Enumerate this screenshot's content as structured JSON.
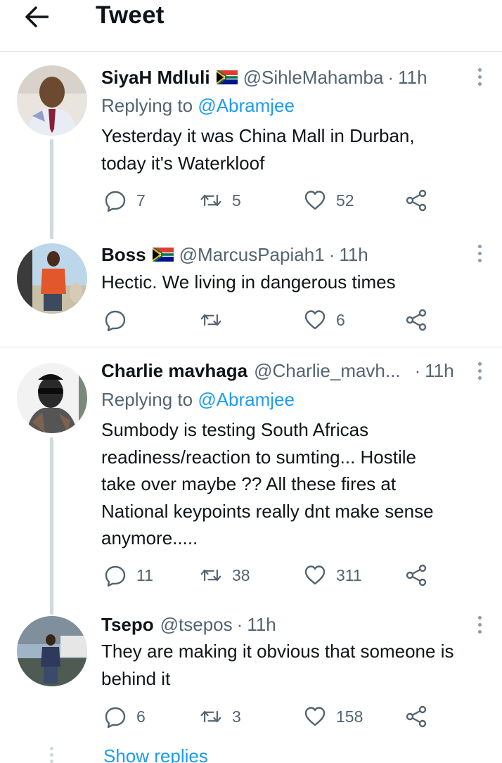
{
  "header": {
    "title": "Tweet",
    "back_icon": "arrow-left-icon"
  },
  "tweets": [
    {
      "name": "SiyaH Mdluli",
      "flag": true,
      "handle": "@SihleMahamba",
      "time": "11h",
      "replying_label": "Replying to",
      "replying_to": "@Abramjee",
      "text_lines": [
        "Yesterday it was China Mall in Durban,",
        "today it's Waterkloof"
      ],
      "replies": "7",
      "retweets": "5",
      "likes": "52"
    },
    {
      "name": "Boss",
      "flag": true,
      "handle": "@MarcusPapiah1",
      "time": "11h",
      "text_lines": [
        "Hectic. We living in dangerous times"
      ],
      "replies": "",
      "retweets": "",
      "likes": "6"
    },
    {
      "name": "Charlie mavhaga",
      "flag": false,
      "handle": "@Charlie_mavh...",
      "time": "11h",
      "replying_label": "Replying to",
      "replying_to": "@Abramjee",
      "text_lines": [
        "Sumbody is testing South Africas",
        "readiness/reaction to sumting... Hostile",
        "take over maybe ?? All these fires at",
        "National keypoints really dnt make sense",
        "anymore....."
      ],
      "replies": "11",
      "retweets": "38",
      "likes": "311"
    },
    {
      "name": "Tsepo",
      "flag": false,
      "handle": "@tsepos",
      "time": "11h",
      "text_lines": [
        "They are making it obvious that someone is",
        "behind it"
      ],
      "replies": "6",
      "retweets": "3",
      "likes": "158"
    }
  ],
  "show_replies": "Show replies",
  "colors": {
    "accent": "#1d9bf0",
    "secondary_text": "#536471",
    "thread_line": "#cfd9de"
  }
}
